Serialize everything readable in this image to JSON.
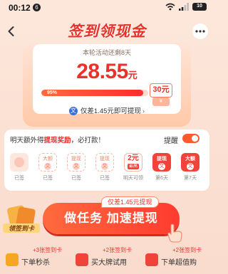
{
  "status_bar": {
    "time": "00:12",
    "notification_count": "6",
    "battery": "10"
  },
  "header": {
    "title": "签到领现金"
  },
  "reward": {
    "countdown": "本轮活动还剩8天",
    "amount": "28.55",
    "unit": "元",
    "progress_label": "95%",
    "progress_fraction": 0.95,
    "target_amount": "30元",
    "target_icon_label": "¥",
    "notice": "仅差1.45元即可提现"
  },
  "checkin": {
    "tip_prefix": "明天额外得",
    "tip_highlight": "提现奖励",
    "tip_suffix": "，必打款！",
    "remind_label": "提醒",
    "remind_on": true,
    "days": [
      {
        "state": "done",
        "label": "已签"
      },
      {
        "state": "gift",
        "mini": "大额",
        "label": "已签"
      },
      {
        "state": "gift",
        "mini": "提现",
        "label": "已签"
      },
      {
        "state": "gift",
        "mini": "提现",
        "label": "已签"
      },
      {
        "state": "cash",
        "value": "2元",
        "sub": "最高",
        "label": "明天可领"
      },
      {
        "state": "hot",
        "mini": "提现",
        "label": "第6天"
      },
      {
        "state": "hot",
        "mini": "大额",
        "label": "第7天"
      }
    ]
  },
  "cta": {
    "label": "做任务 加速提现",
    "tag": "仅差1.45元提现",
    "card_badge": "领签到卡"
  },
  "tasks": [
    {
      "reward": "+3张签到卡",
      "name": "下单秒杀",
      "icon": "lightning-icon"
    },
    {
      "reward": "+2张签到卡",
      "name": "买大牌试用",
      "icon": "bag-icon"
    },
    {
      "reward": "+2张签到卡",
      "name": "下单超值购",
      "icon": "cart-icon"
    }
  ],
  "colors": {
    "accent": "#e8322a",
    "button": "#ff3b2f",
    "background": "#fde7db"
  }
}
